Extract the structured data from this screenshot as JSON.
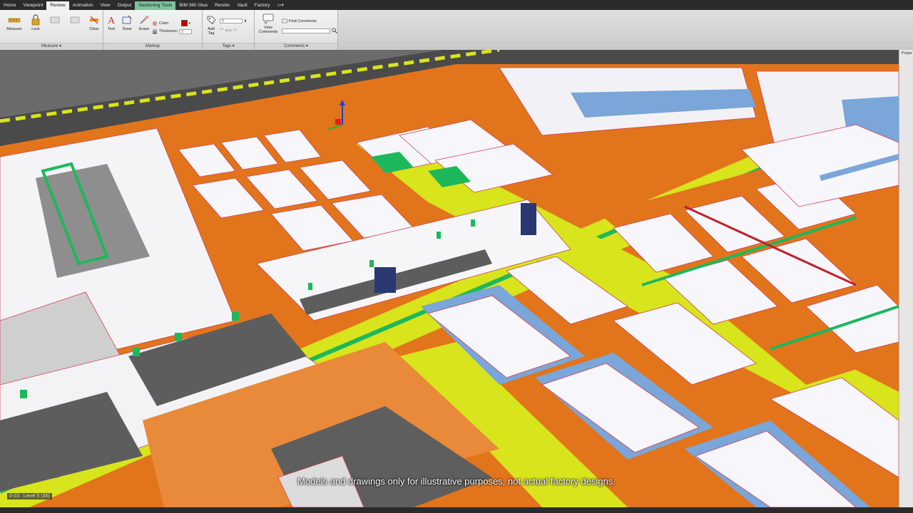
{
  "tabs": [
    {
      "label": "Home",
      "active": false
    },
    {
      "label": "Viewpoint",
      "active": false
    },
    {
      "label": "Review",
      "active": true
    },
    {
      "label": "Animation",
      "active": false
    },
    {
      "label": "View",
      "active": false
    },
    {
      "label": "Output",
      "active": false
    },
    {
      "label": "Sectioning Tools",
      "contextual": true
    },
    {
      "label": "BIM 360 Glue",
      "active": false
    },
    {
      "label": "Render",
      "active": false
    },
    {
      "label": "Vault",
      "active": false
    },
    {
      "label": "Factory",
      "active": false
    }
  ],
  "ribbon": {
    "measure": {
      "measure_label": "Measure",
      "lock_label": "Lock",
      "clear_label": "Clear",
      "footer": "Measure ▾"
    },
    "markup": {
      "text_label": "Text",
      "draw_label": "Draw",
      "erase_label": "Erase",
      "color_label": "Color:",
      "thickness_label": "Thickness:",
      "thickness_value": "3",
      "footer": "Markup"
    },
    "tags": {
      "add_tag_label": "Add Tag",
      "tag_value": "0",
      "footer": "Tags ▾"
    },
    "comments": {
      "view_comments_label": "View Comments",
      "find_comments_label": "Find Comments",
      "footer": "Comments ▾"
    }
  },
  "colors": {
    "markup_color": "#c00000",
    "floor_orange": "#e2741c",
    "walkway_yellow": "#d8e41c",
    "green_line": "#1db85c",
    "blue_zone": "#7aa6d9"
  },
  "viewport": {
    "level_badge": "0-23 : Level 5 (35)",
    "caption": "Models and drawings only for illustrative purposes, not actual factory designs."
  },
  "properties_label": "Prope"
}
